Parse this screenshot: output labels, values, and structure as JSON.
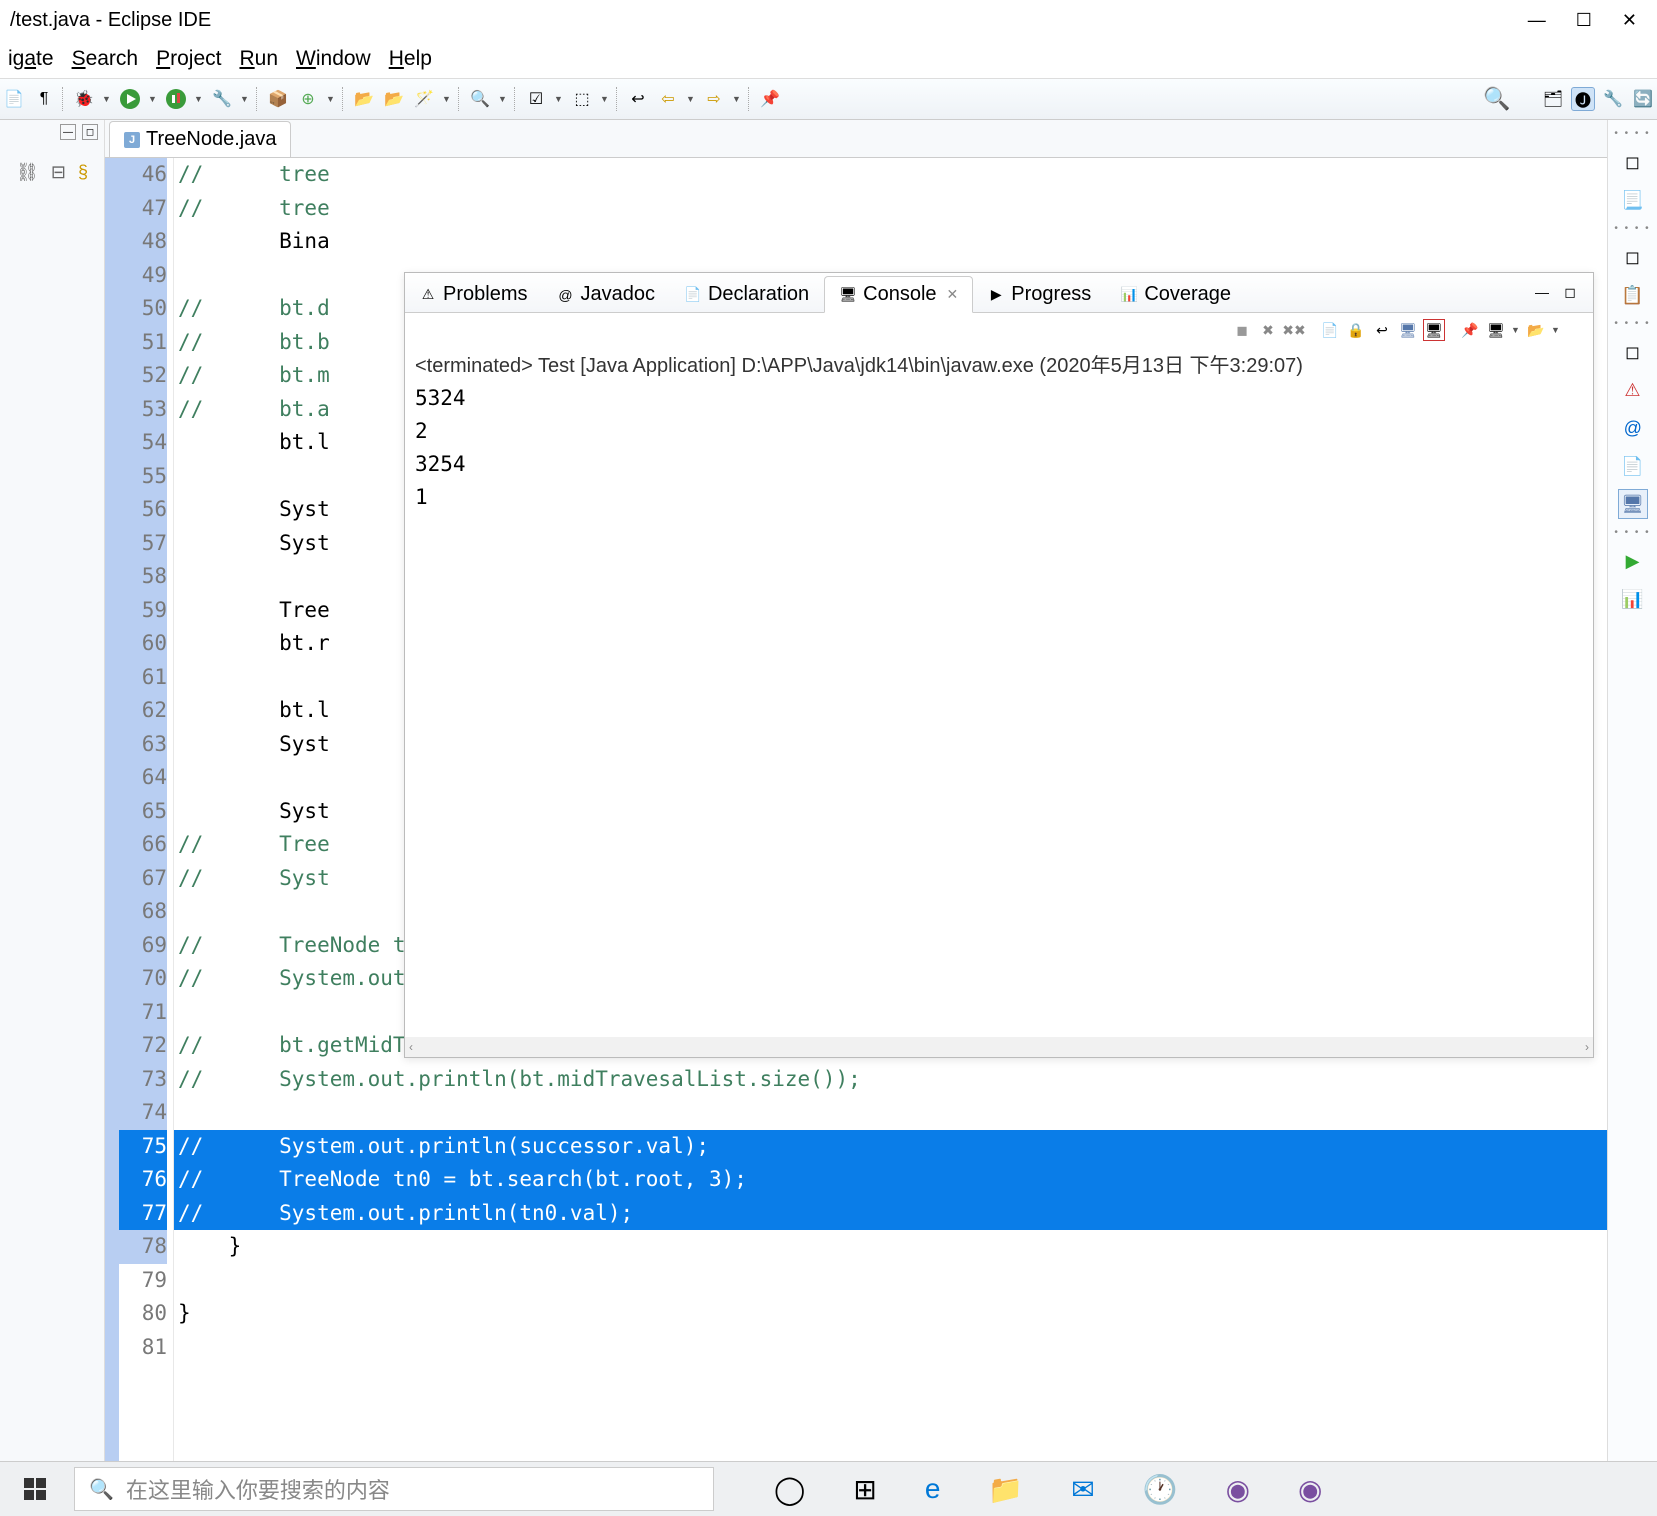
{
  "window": {
    "title": "/test.java - Eclipse IDE"
  },
  "menu": [
    "igate",
    "Search",
    "Project",
    "Run",
    "Window",
    "Help"
  ],
  "menu_underline": [
    2,
    0,
    0,
    0,
    0,
    0
  ],
  "editor_tab": {
    "filename": "TreeNode.java",
    "icon_letter": "J"
  },
  "code": {
    "lines": [
      {
        "n": 46,
        "mod": true,
        "sel": false,
        "comment": true,
        "text": "//      tree"
      },
      {
        "n": 47,
        "mod": true,
        "sel": false,
        "comment": true,
        "text": "//      tree"
      },
      {
        "n": 48,
        "mod": true,
        "sel": false,
        "comment": false,
        "text": "        Bina"
      },
      {
        "n": 49,
        "mod": true,
        "sel": false,
        "comment": false,
        "text": ""
      },
      {
        "n": 50,
        "mod": true,
        "sel": false,
        "comment": true,
        "text": "//      bt.d"
      },
      {
        "n": 51,
        "mod": true,
        "sel": false,
        "comment": true,
        "text": "//      bt.b"
      },
      {
        "n": 52,
        "mod": true,
        "sel": false,
        "comment": true,
        "text": "//      bt.m"
      },
      {
        "n": 53,
        "mod": true,
        "sel": false,
        "comment": true,
        "text": "//      bt.a"
      },
      {
        "n": 54,
        "mod": true,
        "sel": false,
        "comment": false,
        "text": "        bt.l"
      },
      {
        "n": 55,
        "mod": true,
        "sel": false,
        "comment": false,
        "text": ""
      },
      {
        "n": 56,
        "mod": true,
        "sel": false,
        "comment": false,
        "text": "        Syst"
      },
      {
        "n": 57,
        "mod": true,
        "sel": false,
        "comment": false,
        "text": "        Syst"
      },
      {
        "n": 58,
        "mod": true,
        "sel": false,
        "comment": false,
        "text": ""
      },
      {
        "n": 59,
        "mod": true,
        "sel": false,
        "comment": false,
        "text": "        Tree"
      },
      {
        "n": 60,
        "mod": true,
        "sel": false,
        "comment": false,
        "text": "        bt.r"
      },
      {
        "n": 61,
        "mod": true,
        "sel": false,
        "comment": false,
        "text": ""
      },
      {
        "n": 62,
        "mod": true,
        "sel": false,
        "comment": false,
        "text": "        bt.l"
      },
      {
        "n": 63,
        "mod": true,
        "sel": false,
        "comment": false,
        "text": "        Syst"
      },
      {
        "n": 64,
        "mod": true,
        "sel": false,
        "comment": false,
        "text": ""
      },
      {
        "n": 65,
        "mod": true,
        "sel": false,
        "comment": false,
        "text": "        Syst"
      },
      {
        "n": 66,
        "mod": true,
        "sel": false,
        "comment": true,
        "text": "//      Tree"
      },
      {
        "n": 67,
        "mod": true,
        "sel": false,
        "comment": true,
        "text": "//      Syst"
      },
      {
        "n": 68,
        "mod": true,
        "sel": false,
        "comment": false,
        "text": ""
      },
      {
        "n": 69,
        "mod": true,
        "sel": false,
        "comment": true,
        "text": "//      TreeNode tn = bt.getSuccessor(root);"
      },
      {
        "n": 70,
        "mod": true,
        "sel": false,
        "comment": true,
        "text": "//      System.out.println(tn.val);"
      },
      {
        "n": 71,
        "mod": true,
        "sel": false,
        "comment": false,
        "text": ""
      },
      {
        "n": 72,
        "mod": true,
        "sel": false,
        "comment": true,
        "text": "//      bt.getMidTraversal(root);"
      },
      {
        "n": 73,
        "mod": true,
        "sel": false,
        "comment": true,
        "text": "//      System.out.println(bt.midTravesalList.size());"
      },
      {
        "n": 74,
        "mod": true,
        "sel": false,
        "comment": false,
        "text": ""
      },
      {
        "n": 75,
        "mod": true,
        "sel": true,
        "comment": true,
        "text": "//      System.out.println(successor.val);"
      },
      {
        "n": 76,
        "mod": true,
        "sel": true,
        "comment": true,
        "text": "//      TreeNode tn0 = bt.search(bt.root, 3);"
      },
      {
        "n": 77,
        "mod": true,
        "sel": true,
        "comment": true,
        "text": "//      System.out.println(tn0.val);"
      },
      {
        "n": 78,
        "mod": true,
        "sel": false,
        "comment": false,
        "text": "    }"
      },
      {
        "n": 79,
        "mod": false,
        "sel": false,
        "comment": false,
        "text": ""
      },
      {
        "n": 80,
        "mod": false,
        "sel": false,
        "comment": false,
        "text": "}"
      },
      {
        "n": 81,
        "mod": false,
        "sel": false,
        "comment": false,
        "text": ""
      }
    ]
  },
  "console": {
    "tabs": [
      {
        "label": "Problems",
        "icon": "⚠",
        "active": false
      },
      {
        "label": "Javadoc",
        "icon": "@",
        "active": false
      },
      {
        "label": "Declaration",
        "icon": "📄",
        "active": false
      },
      {
        "label": "Console",
        "icon": "🖥",
        "active": true
      },
      {
        "label": "Progress",
        "icon": "▶",
        "active": false
      },
      {
        "label": "Coverage",
        "icon": "📊",
        "active": false
      }
    ],
    "header": "<terminated> Test [Java Application] D:\\APP\\Java\\jdk14\\bin\\javaw.exe (2020年5月13日 下午3:29:07)",
    "output": [
      "5324",
      "2",
      "3254",
      "1"
    ]
  },
  "taskbar": {
    "search_placeholder": "在这里输入你要搜索的内容"
  }
}
